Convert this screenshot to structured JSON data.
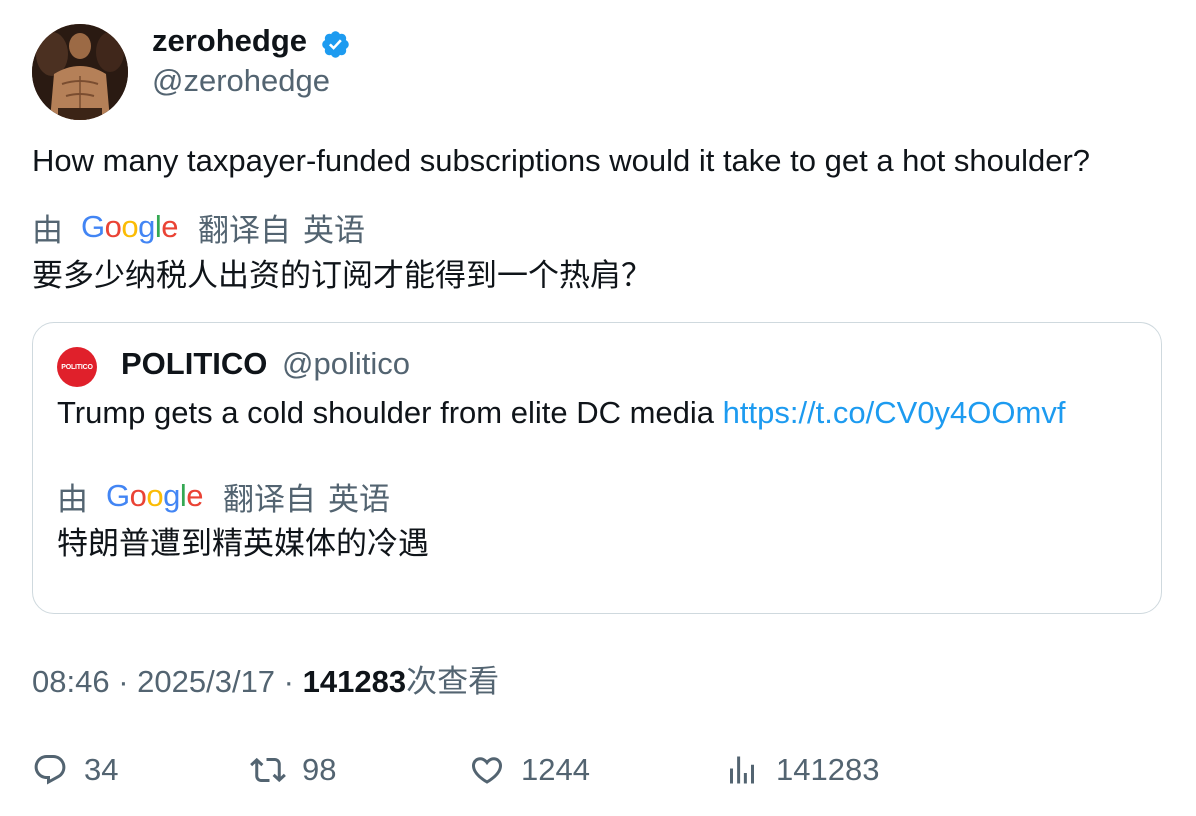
{
  "author": {
    "display_name": "zerohedge",
    "handle": "@zerohedge",
    "verified": true,
    "verified_color": "#1d9bf0"
  },
  "tweet": {
    "text": "How many taxpayer-funded subscriptions would it take to get a hot shoulder?",
    "translation": {
      "by_label": "由",
      "provider": "Google",
      "from_label": "翻译自",
      "language": "英语",
      "text": "要多少纳税人出资的订阅才能得到一个热肩？"
    }
  },
  "quote": {
    "avatar_text": "POLITICO",
    "avatar_color": "#e0202b",
    "display_name": "POLITICO",
    "handle": "@politico",
    "text": "Trump gets a cold shoulder from elite DC media ",
    "link": "https://t.co/CV0y4OOmvf",
    "translation": {
      "by_label": "由",
      "provider": "Google",
      "from_label": "翻译自",
      "language": "英语",
      "text": "特朗普遭到精英媒体的冷遇"
    }
  },
  "meta": {
    "time": "08:46",
    "separator": " · ",
    "date": "2025/3/17",
    "views_count": "141283",
    "views_label": "次查看"
  },
  "actions": {
    "replies": "34",
    "retweets": "98",
    "likes": "1244",
    "views": "141283"
  },
  "colors": {
    "text": "#0f1419",
    "secondary": "#536471",
    "link": "#1d9bf0",
    "border": "#cfd9de"
  }
}
